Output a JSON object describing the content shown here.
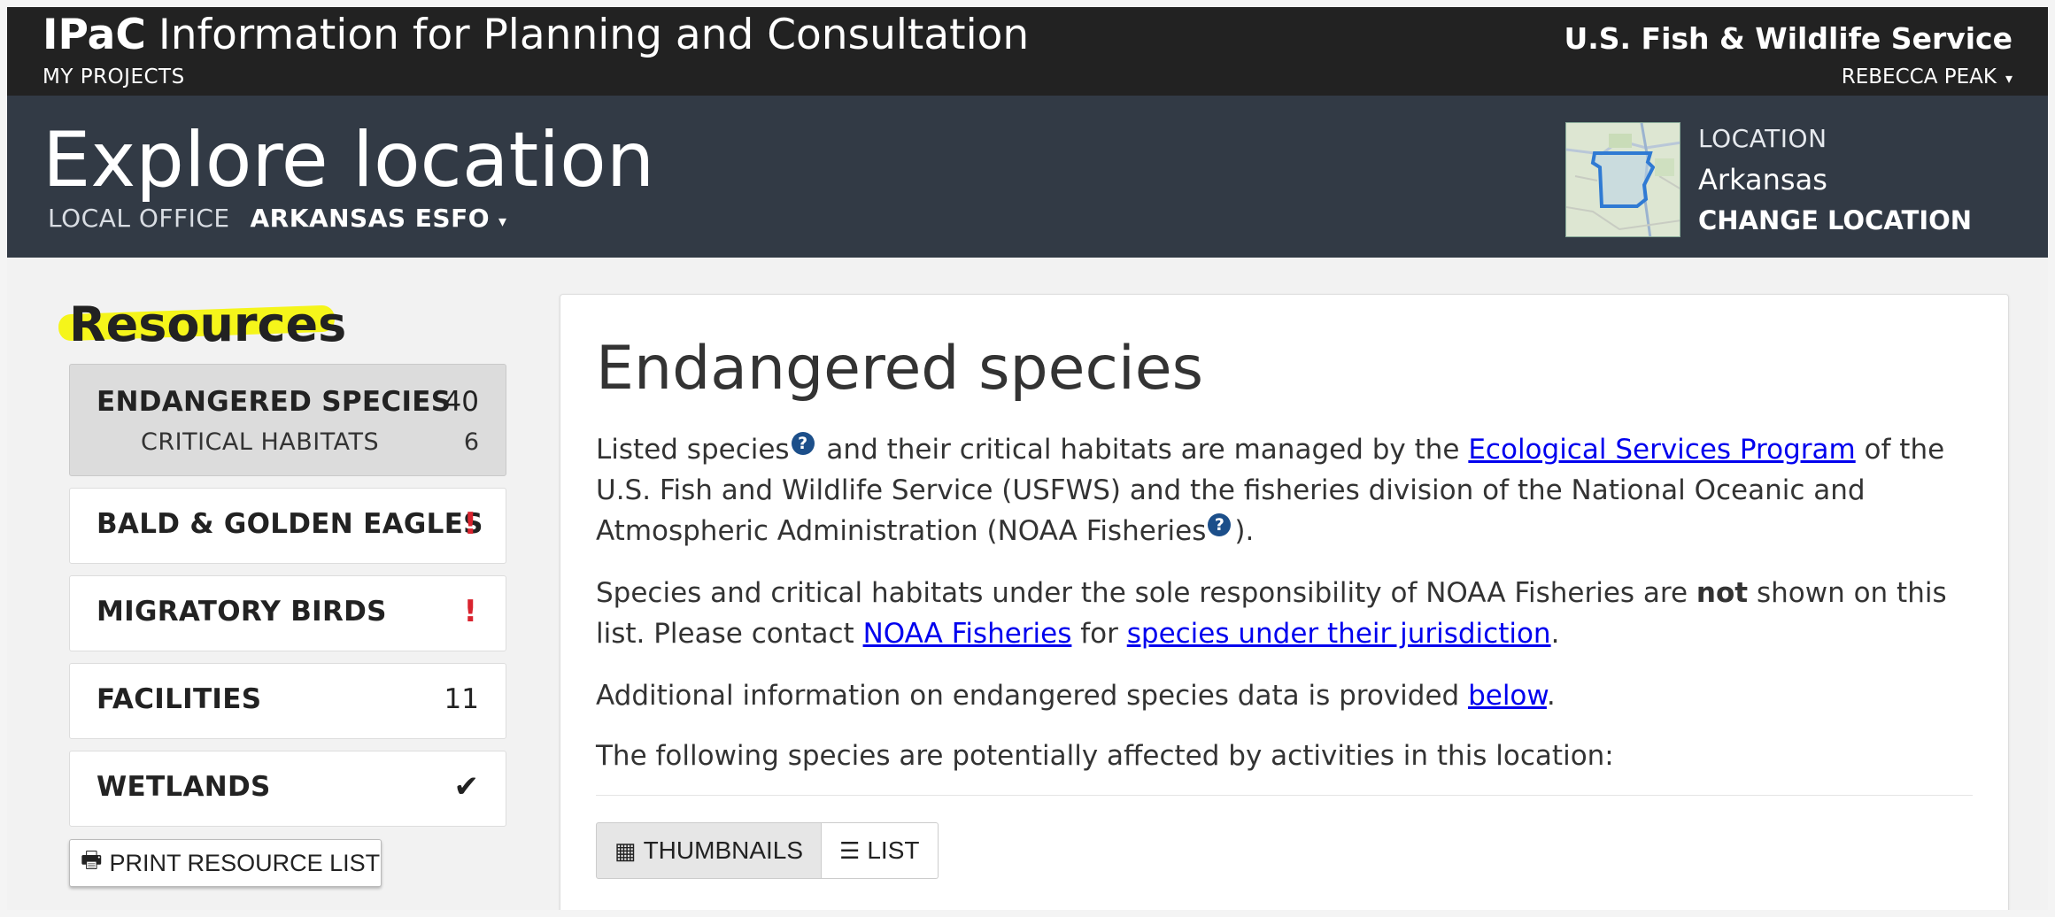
{
  "topbar": {
    "brand_abbr": "IPaC",
    "brand_full": "Information for Planning and Consultation",
    "my_projects": "MY PROJECTS",
    "agency": "U.S. Fish & Wildlife Service",
    "user_name": "REBECCA PEAK",
    "user_caret": "▾"
  },
  "header": {
    "title": "Explore location",
    "office_label": "LOCAL OFFICE",
    "office_value": "ARKANSAS ESFO",
    "office_caret": "▾",
    "location_label": "LOCATION",
    "location_value": "Arkansas",
    "change_location": "CHANGE LOCATION"
  },
  "sidebar": {
    "title": "Resources",
    "items": [
      {
        "label": "ENDANGERED SPECIES",
        "count": "40",
        "sub_label": "CRITICAL HABITATS",
        "sub_count": "6"
      },
      {
        "label": "BALD & GOLDEN EAGLES",
        "alert": "!"
      },
      {
        "label": "MIGRATORY BIRDS",
        "alert": "!"
      },
      {
        "label": "FACILITIES",
        "count": "11"
      },
      {
        "label": "WETLANDS",
        "check": "✔"
      }
    ],
    "print_label": "PRINT RESOURCE LIST",
    "print_icon": "🖶"
  },
  "main": {
    "title": "Endangered species",
    "p1": {
      "t1": "Listed species",
      "help1": "?",
      "t2": " and their critical habitats are managed by the ",
      "link1": "Ecological Services Program",
      "t3": " of the U.S. Fish and Wildlife Service (USFWS) and the fisheries division of the National Oceanic and Atmospheric Administration (NOAA Fisheries",
      "help2": "?",
      "t4": ")."
    },
    "p2": {
      "t1": "Species and critical habitats under the sole responsibility of NOAA Fisheries are ",
      "bold": "not",
      "t2": " shown on this list. Please contact ",
      "link1": "NOAA Fisheries",
      "t3": " for ",
      "link2": "species under their jurisdiction",
      "t4": "."
    },
    "p3": {
      "t1": "Additional information on endangered species data is provided ",
      "link1": "below",
      "t2": "."
    },
    "p4": "The following species are potentially affected by activities in this location:",
    "view_thumbnails": "THUMBNAILS",
    "view_list": "LIST",
    "thumbnails_icon": "▦",
    "list_icon": "☰"
  },
  "colors": {
    "topbar_bg": "#222222",
    "header_bg": "#323a45",
    "alert_red": "#d9232e",
    "help_blue": "#1c4f8a",
    "highlight_yellow": "#f5f51a"
  }
}
